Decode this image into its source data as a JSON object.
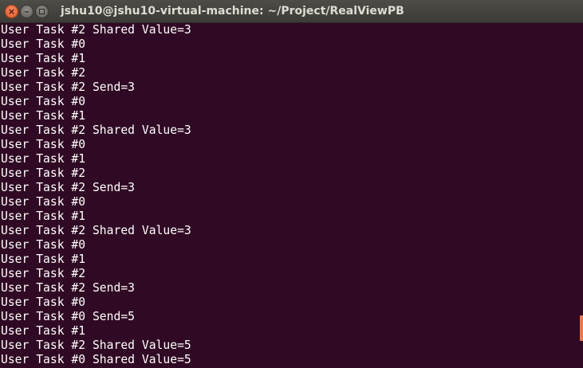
{
  "window": {
    "title": "jshu10@jshu10-virtual-machine: ~/Project/RealViewPB",
    "close_glyph": "×",
    "minimize_glyph": "–"
  },
  "colors": {
    "terminal_bg": "#300a24",
    "terminal_fg": "#ffffff",
    "scroll_marker": "#f07746",
    "close_button": "#e45a26"
  },
  "icons": {
    "close": "close-icon",
    "minimize": "minimize-icon",
    "maximize": "maximize-icon"
  },
  "terminal": {
    "lines": [
      "User Task #2 Shared Value=3",
      "User Task #0",
      "User Task #1",
      "User Task #2",
      "User Task #2 Send=3",
      "User Task #0",
      "User Task #1",
      "User Task #2 Shared Value=3",
      "User Task #0",
      "User Task #1",
      "User Task #2",
      "User Task #2 Send=3",
      "User Task #0",
      "User Task #1",
      "User Task #2 Shared Value=3",
      "User Task #0",
      "User Task #1",
      "User Task #2",
      "User Task #2 Send=3",
      "User Task #0",
      "User Task #0 Send=5",
      "User Task #1",
      "User Task #2 Shared Value=5",
      "User Task #0 Shared Value=5"
    ]
  }
}
